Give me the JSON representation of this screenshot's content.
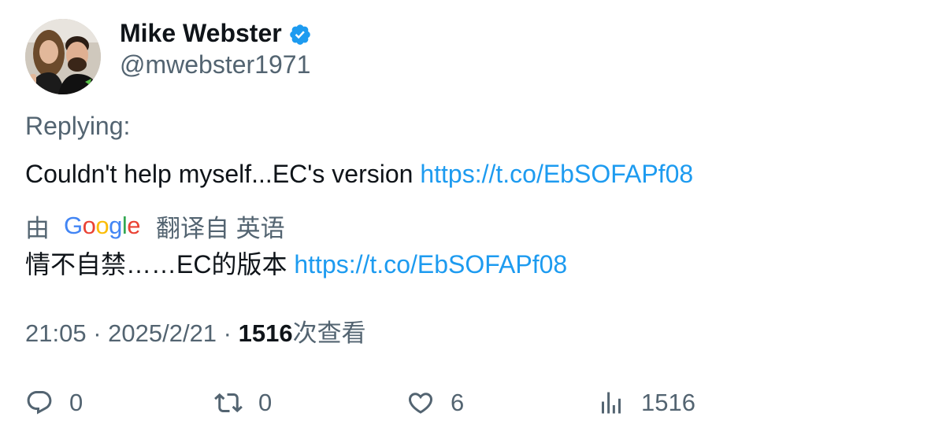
{
  "author": {
    "display_name": "Mike Webster",
    "handle": "@mwebster1971",
    "verified_icon": "verified-badge-icon",
    "avatar": "avatar"
  },
  "replying_label": "Replying:",
  "tweet": {
    "text": "Couldn't help myself...EC's version ",
    "link": "https://t.co/EbSOFAPf08"
  },
  "translation": {
    "prefix": "由",
    "provider": "Google",
    "suffix": "翻译自 英语",
    "text": "情不自禁……EC的版本 ",
    "link": "https://t.co/EbSOFAPf08"
  },
  "meta": {
    "time": "21:05",
    "separator": " · ",
    "date": "2025/2/21",
    "views_count": "1516",
    "views_label": "次查看"
  },
  "actions": {
    "reply": {
      "icon": "reply-icon",
      "count": "0"
    },
    "retweet": {
      "icon": "retweet-icon",
      "count": "0"
    },
    "like": {
      "icon": "heart-icon",
      "count": "6"
    },
    "views": {
      "icon": "analytics-icon",
      "count": "1516"
    }
  },
  "colors": {
    "link": "#1d9bf0",
    "secondary_text": "#536471",
    "primary_text": "#0f1419",
    "verified": "#1d9bf0"
  }
}
